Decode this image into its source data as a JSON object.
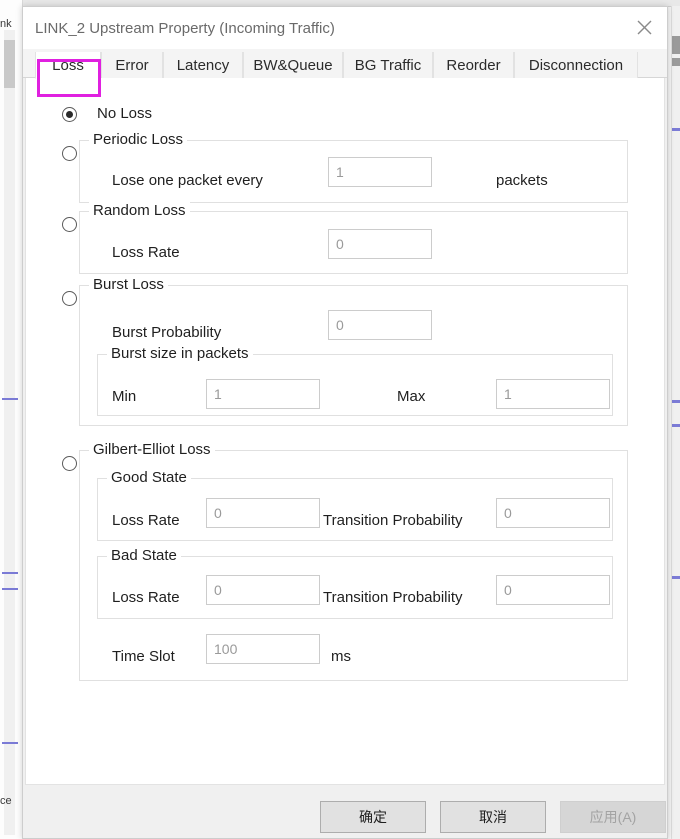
{
  "background": {
    "left_fragment_top": "nk",
    "left_fragment_bottom": "ce"
  },
  "dialog": {
    "title": "LINK_2 Upstream Property (Incoming Traffic)",
    "close_icon": "close-icon"
  },
  "tabs": {
    "active_index": 0,
    "items": [
      {
        "label": "Loss"
      },
      {
        "label": "Error"
      },
      {
        "label": "Latency"
      },
      {
        "label": "BW&Queue"
      },
      {
        "label": "BG Traffic"
      },
      {
        "label": "Reorder"
      },
      {
        "label": "Disconnection"
      }
    ],
    "highlight_color": "#e020e0"
  },
  "loss_tab": {
    "selected_mode": "no_loss",
    "no_loss": {
      "label": "No Loss",
      "selected": true
    },
    "periodic_loss": {
      "title": "Periodic Loss",
      "selected": false,
      "field_label": "Lose one packet every",
      "field_value": "1",
      "unit": "packets"
    },
    "random_loss": {
      "title": "Random Loss",
      "selected": false,
      "field_label": "Loss Rate",
      "field_value": "0"
    },
    "burst_loss": {
      "title": "Burst Loss",
      "selected": false,
      "probability_label": "Burst Probability",
      "probability_value": "0",
      "size_group_title": "Burst size in packets",
      "min_label": "Min",
      "min_value": "1",
      "max_label": "Max",
      "max_value": "1"
    },
    "gilbert_elliot_loss": {
      "title": "Gilbert-Elliot Loss",
      "selected": false,
      "good_state": {
        "title": "Good State",
        "loss_rate_label": "Loss Rate",
        "loss_rate_value": "0",
        "transition_label": "Transition Probability",
        "transition_value": "0"
      },
      "bad_state": {
        "title": "Bad State",
        "loss_rate_label": "Loss Rate",
        "loss_rate_value": "0",
        "transition_label": "Transition Probability",
        "transition_value": "0"
      },
      "time_slot_label": "Time Slot",
      "time_slot_value": "100",
      "time_slot_unit": "ms"
    }
  },
  "footer": {
    "ok_label": "确定",
    "cancel_label": "取消",
    "apply_label": "应用(A)",
    "apply_disabled": true
  }
}
